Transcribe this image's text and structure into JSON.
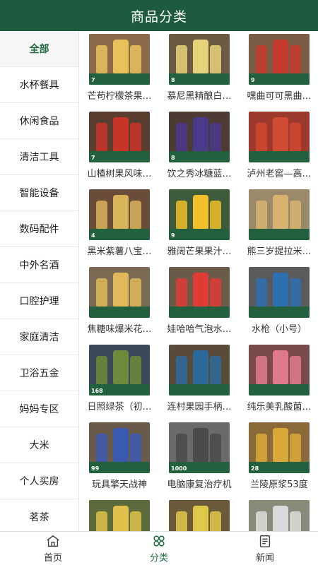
{
  "header": {
    "title": "商品分类"
  },
  "sidebar": {
    "items": [
      {
        "label": "全部",
        "active": true
      },
      {
        "label": "水杯餐具"
      },
      {
        "label": "休闲食品"
      },
      {
        "label": "清洁工具"
      },
      {
        "label": "智能设备"
      },
      {
        "label": "数码配件"
      },
      {
        "label": "中外名酒"
      },
      {
        "label": "口腔护理"
      },
      {
        "label": "家庭清洁"
      },
      {
        "label": "卫浴五金"
      },
      {
        "label": "妈妈专区"
      },
      {
        "label": "大米"
      },
      {
        "label": "个人买房"
      },
      {
        "label": "茗茶"
      }
    ]
  },
  "products": [
    {
      "name": "芒苟柠檬茶果…",
      "price": "7",
      "bg": "#8a6a4a",
      "obj": "#e8c15a"
    },
    {
      "name": "慕尼黑精酿白…",
      "price": "8",
      "bg": "#6b5a44",
      "obj": "#e8d27a"
    },
    {
      "name": "嘿曲可可黑曲…",
      "price": "9",
      "bg": "#7a5d46",
      "obj": "#c73b2e"
    },
    {
      "name": "山楂树果风味…",
      "price": "7",
      "bg": "#5a3d2e",
      "obj": "#c83428"
    },
    {
      "name": "饮之秀冰糖蓝…",
      "price": "8",
      "bg": "#4d3b33",
      "obj": "#4a3a8c"
    },
    {
      "name": "泸州老窖—高…",
      "price": "",
      "bg": "#9b3a2c",
      "obj": "#d14a32"
    },
    {
      "name": "黑米紫薯八宝…",
      "price": "4",
      "bg": "#6b4c3a",
      "obj": "#d9b35a"
    },
    {
      "name": "雅阔芒果果汁…",
      "price": "9",
      "bg": "#3d5a3a",
      "obj": "#f0c02a"
    },
    {
      "name": "熊三岁提拉米…",
      "price": "",
      "bg": "#9a8a6a",
      "obj": "#d8b370"
    },
    {
      "name": "焦糖味爆米花…",
      "price": "",
      "bg": "#7a6a52",
      "obj": "#e0b85a"
    },
    {
      "name": "娃哈哈气泡水…",
      "price": "",
      "bg": "#6a5a4a",
      "obj": "#e03a34"
    },
    {
      "name": "水枪（小号）",
      "price": "",
      "bg": "#5a5a5a",
      "obj": "#2e6fb0"
    },
    {
      "name": "日照绿茶（初…",
      "price": "168",
      "bg": "#3a4a5a",
      "obj": "#6c8a3a"
    },
    {
      "name": "连村果园手柄…",
      "price": "",
      "bg": "#5a4a3a",
      "obj": "#2b6a9a"
    },
    {
      "name": "纯乐美乳酸菌…",
      "price": "",
      "bg": "#7a4a4a",
      "obj": "#e07a8a"
    },
    {
      "name": "玩具擎天战神",
      "price": "99",
      "bg": "#6a5a4a",
      "obj": "#3a5ab0"
    },
    {
      "name": "电脑康复治疗机",
      "price": "1000",
      "bg": "#6a6a6a",
      "obj": "#4a4a4a"
    },
    {
      "name": "兰陵原浆53度",
      "price": "28",
      "bg": "#8a6a3a",
      "obj": "#d8a83a"
    },
    {
      "name": "",
      "price": "",
      "bg": "#5a6a3a",
      "obj": "#e0c04a"
    },
    {
      "name": "",
      "price": "",
      "bg": "#6a5a3a",
      "obj": "#e0c84a"
    },
    {
      "name": "",
      "price": "",
      "bg": "#8a8a7a",
      "obj": "#dadada"
    }
  ],
  "tabbar": {
    "items": [
      {
        "label": "首页",
        "icon": "home-icon"
      },
      {
        "label": "分类",
        "icon": "category-icon",
        "active": true
      },
      {
        "label": "新闻",
        "icon": "news-icon"
      }
    ]
  },
  "colors": {
    "primary": "#1e5a3c",
    "active_text": "#1e6b3f"
  }
}
